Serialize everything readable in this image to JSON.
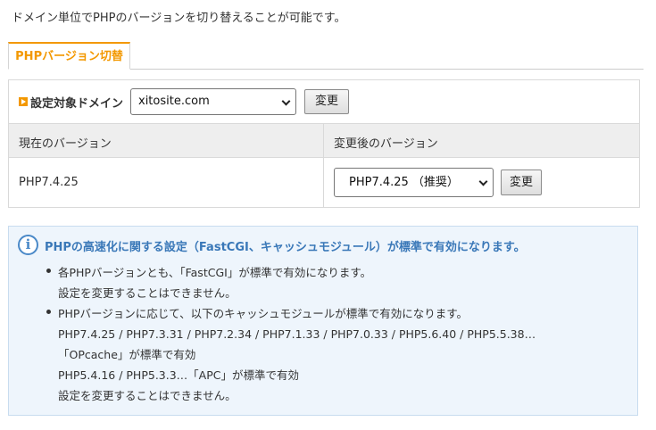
{
  "intro": "ドメイン単位でPHPのバージョンを切り替えることが可能です。",
  "tab": {
    "label": "PHPバージョン切替",
    "accent": "#f39800"
  },
  "domain": {
    "label": "設定対象ドメイン",
    "selected": "xitosite.com",
    "button": "変更"
  },
  "table": {
    "headers": [
      "現在のバージョン",
      "変更後のバージョン"
    ],
    "current_version": "PHP7.4.25",
    "new_version_selected": "PHP7.4.25 （推奨）",
    "change_button": "変更"
  },
  "info": {
    "icon": "info-icon",
    "title": "PHPの高速化に関する設定（FastCGI、キャッシュモジュール）が標準で有効になります。",
    "items": [
      {
        "lines": [
          "各PHPバージョンとも、「FastCGI」が標準で有効になります。",
          "設定を変更することはできません。"
        ]
      },
      {
        "lines": [
          "PHPバージョンに応じて、以下のキャッシュモジュールが標準で有効になります。",
          "PHP7.4.25 / PHP7.3.31 / PHP7.2.34 / PHP7.1.33 / PHP7.0.33 / PHP5.6.40 / PHP5.5.38…",
          "「OPcache」が標準で有効",
          "PHP5.4.16 / PHP5.3.3…「APC」が標準で有効",
          "設定を変更することはできません。"
        ]
      }
    ]
  }
}
